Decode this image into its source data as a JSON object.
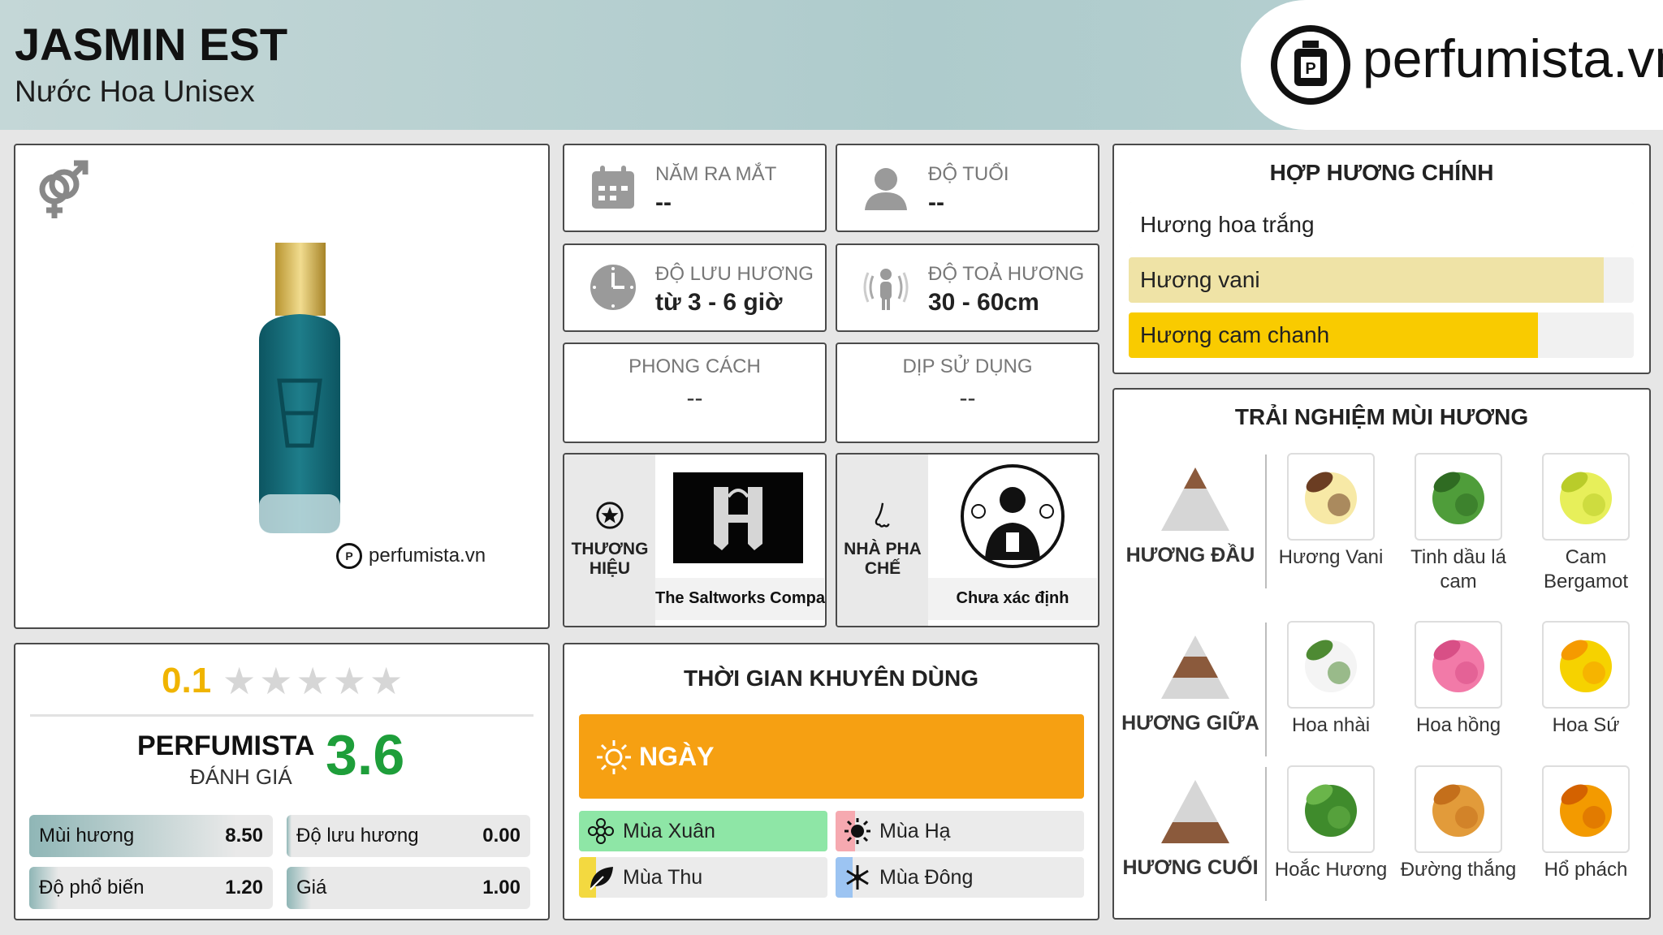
{
  "header": {
    "title": "JASMIN EST",
    "subtitle": "Nước Hoa Unisex",
    "logo_text": "perfumista.vn"
  },
  "product": {
    "watermark": "perfumista.vn",
    "gender_icon": "unisex-icon"
  },
  "info": {
    "year": {
      "label": "NĂM RA MẮT",
      "value": "--",
      "icon": "calendar-icon"
    },
    "age": {
      "label": "ĐỘ TUỔI",
      "value": "--",
      "icon": "person-icon"
    },
    "longevity": {
      "label": "ĐỘ LƯU HƯƠNG",
      "value": "từ 3 - 6 giờ",
      "icon": "clock-icon"
    },
    "sillage": {
      "label": "ĐỘ TOẢ HƯƠNG",
      "value": "30 - 60cm",
      "icon": "radiate-person-icon"
    },
    "style": {
      "label": "PHONG CÁCH",
      "value": "--"
    },
    "occasion": {
      "label": "DỊP SỬ DỤNG",
      "value": "--"
    },
    "brand": {
      "label_1": "THƯƠNG",
      "label_2": "HIỆU",
      "name": "The Saltworks Company",
      "icon": "star-badge-icon"
    },
    "perfumer": {
      "label_1": "NHÀ PHA",
      "label_2": "CHẾ",
      "name": "Chưa xác định",
      "icon": "nose-icon"
    }
  },
  "accords": {
    "title": "HỢP HƯƠNG CHÍNH",
    "items": [
      {
        "name": "Hương hoa trắng",
        "level": 1.0,
        "color": "#ffffff"
      },
      {
        "name": "Hương vani",
        "level": 0.94,
        "color": "#efe3a6"
      },
      {
        "name": "Hương cam chanh",
        "level": 0.81,
        "color": "#f9cb00"
      }
    ]
  },
  "experience": {
    "title": "TRẢI NGHIỆM MÙI HƯƠNG",
    "tiers": [
      {
        "label": "HƯƠNG ĐẦU",
        "notes": [
          "Hương Vani",
          "Tinh dầu lá cam",
          "Cam Bergamot"
        ]
      },
      {
        "label": "HƯƠNG GIỮA",
        "notes": [
          "Hoa nhài",
          "Hoa hồng",
          "Hoa Sứ"
        ]
      },
      {
        "label": "HƯƠNG CUỐI",
        "notes": [
          "Hoắc Hương",
          "Đường thắng",
          "Hổ phách"
        ]
      }
    ]
  },
  "rating": {
    "user_score": "0.1",
    "user_stars": 0.1,
    "pf_label": "PERFUMISTA",
    "pf_sub": "ĐÁNH GIÁ",
    "pf_score": "3.6",
    "metrics": [
      {
        "name": "Mùi hương",
        "value": "8.50",
        "level": 0.85
      },
      {
        "name": "Độ lưu hương",
        "value": "0.00",
        "level": 0.0
      },
      {
        "name": "Độ phổ biến",
        "value": "1.20",
        "level": 0.12
      },
      {
        "name": "Giá",
        "value": "1.00",
        "level": 0.1
      }
    ]
  },
  "time": {
    "title": "THỜI GIAN KHUYÊN DÙNG",
    "day_label": "NGÀY",
    "seasons": [
      {
        "name": "Mùa Xuân",
        "icon": "flower-icon",
        "color": "#8ee6a6",
        "level": 1.0
      },
      {
        "name": "Mùa Hạ",
        "icon": "sun-icon",
        "color": "#f6a9b0",
        "level": 0.08
      },
      {
        "name": "Mùa Thu",
        "icon": "leaf-icon",
        "color": "#f3d940",
        "level": 0.07
      },
      {
        "name": "Mùa Đông",
        "icon": "snowflake-icon",
        "color": "#9cc4f2",
        "level": 0.07
      }
    ]
  }
}
